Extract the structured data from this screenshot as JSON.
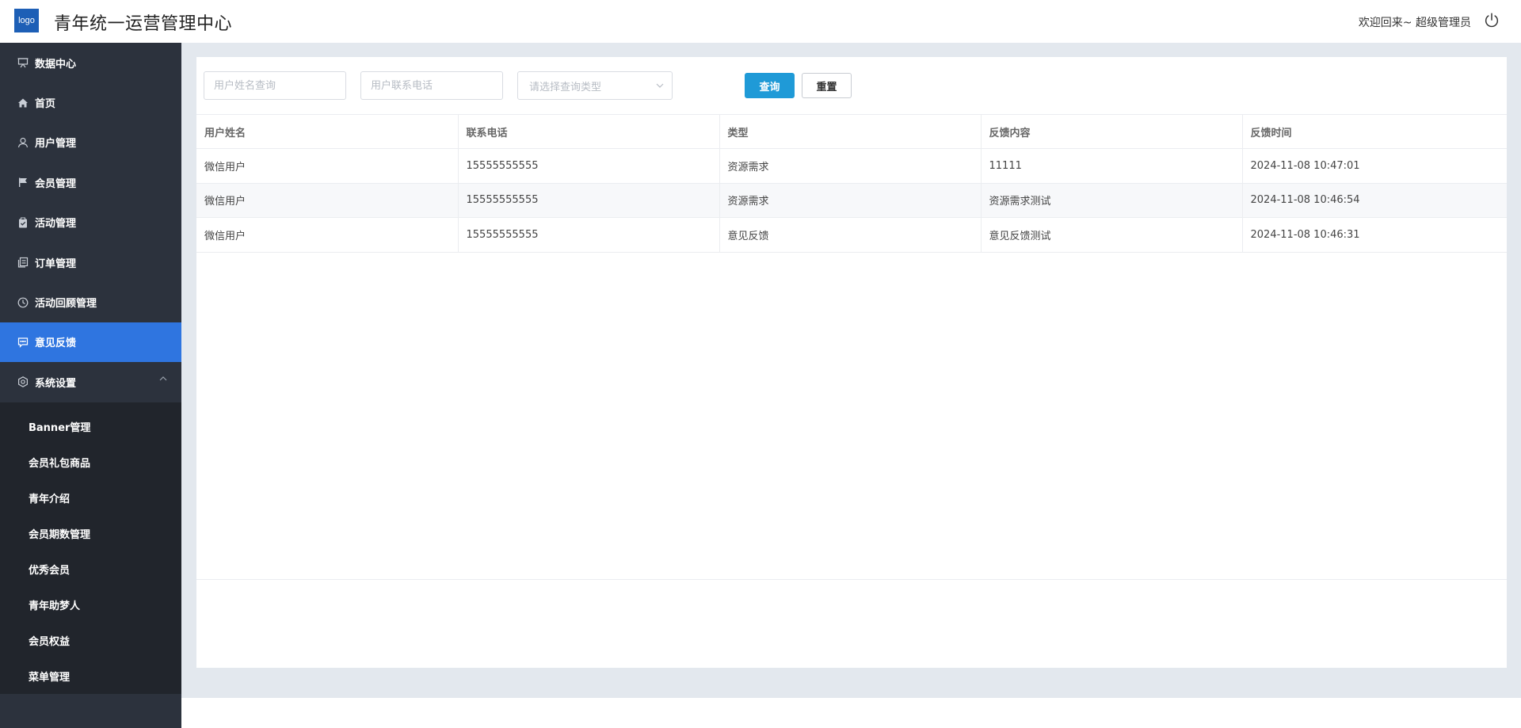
{
  "header": {
    "logo_text": "logo",
    "title": "青年统一运营管理中心",
    "welcome": "欢迎回来~ 超级管理员"
  },
  "sidebar": {
    "items": [
      {
        "label": "数据中心",
        "icon": "presentation-board-icon"
      },
      {
        "label": "首页",
        "icon": "home-icon"
      },
      {
        "label": "用户管理",
        "icon": "user-icon"
      },
      {
        "label": "会员管理",
        "icon": "flag-icon"
      },
      {
        "label": "活动管理",
        "icon": "clipboard-icon"
      },
      {
        "label": "订单管理",
        "icon": "order-list-icon"
      },
      {
        "label": "活动回顾管理",
        "icon": "clock-icon"
      },
      {
        "label": "意见反馈",
        "icon": "message-icon",
        "active": true
      },
      {
        "label": "系统设置",
        "icon": "gear-icon",
        "expanded": true
      }
    ],
    "submenu": [
      "Banner管理",
      "会员礼包商品",
      "青年介绍",
      "会员期数管理",
      "优秀会员",
      "青年助梦人",
      "会员权益",
      "菜单管理"
    ]
  },
  "filters": {
    "name_placeholder": "用户姓名查询",
    "phone_placeholder": "用户联系电话",
    "type_placeholder": "请选择查询类型",
    "search_label": "查询",
    "reset_label": "重置"
  },
  "table": {
    "headers": [
      "用户姓名",
      "联系电话",
      "类型",
      "反馈内容",
      "反馈时间"
    ],
    "rows": [
      [
        "微信用户",
        "15555555555",
        "资源需求",
        "11111",
        "2024-11-08 10:47:01"
      ],
      [
        "微信用户",
        "15555555555",
        "资源需求",
        "资源需求测试",
        "2024-11-08 10:46:54"
      ],
      [
        "微信用户",
        "15555555555",
        "意见反馈",
        "意见反馈测试",
        "2024-11-08 10:46:31"
      ]
    ]
  },
  "colors": {
    "sidebar_bg": "#2c323d",
    "submenu_bg": "#21252c",
    "active_bg": "#2f75e0",
    "primary_button": "#1f9ad7",
    "logo_bg": "#1d5fb6"
  }
}
